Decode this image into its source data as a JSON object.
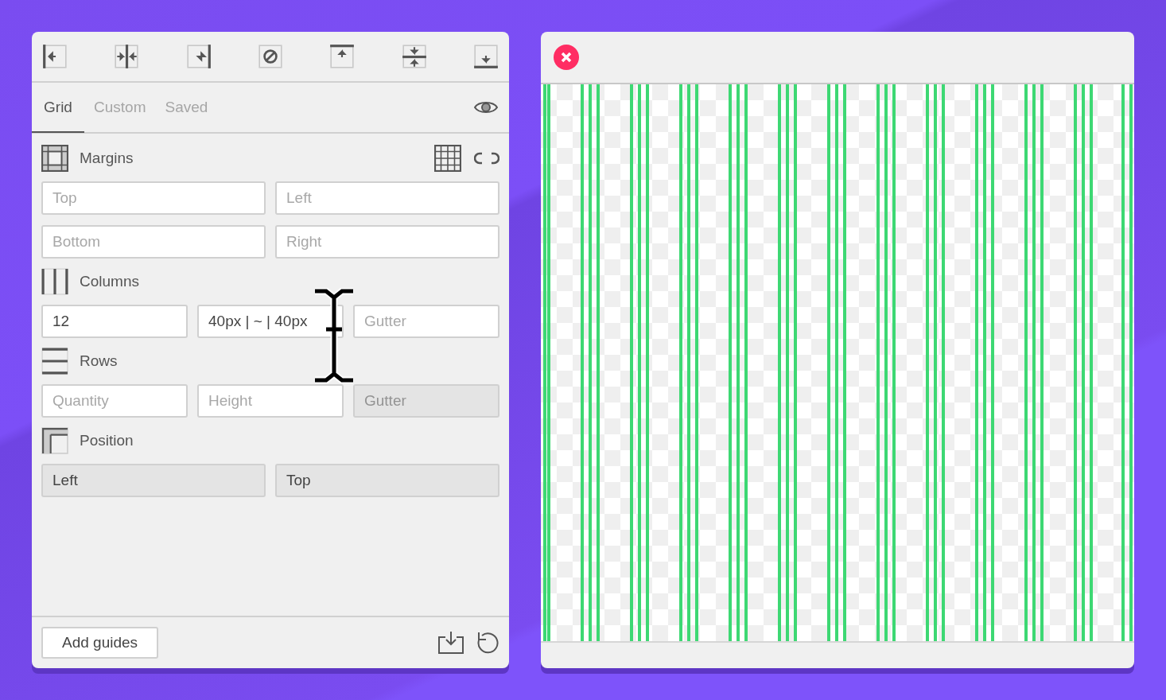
{
  "toolbar": {
    "buttons": [
      {
        "kind": "left"
      },
      {
        "kind": "center-v"
      },
      {
        "kind": "right"
      },
      {
        "kind": "clear"
      },
      {
        "kind": "top"
      },
      {
        "kind": "center-h"
      },
      {
        "kind": "bottom"
      }
    ]
  },
  "tabs": [
    {
      "label": "Grid",
      "selected": true
    },
    {
      "label": "Custom",
      "selected": false
    },
    {
      "label": "Saved",
      "selected": false
    }
  ],
  "sections": [
    {
      "kind": "margins",
      "title": "Margins",
      "fields": [
        {
          "placeholder": "Top",
          "disabled": false
        },
        {
          "placeholder": "Left",
          "disabled": false
        },
        {
          "placeholder": "Bottom",
          "disabled": false
        },
        {
          "placeholder": "Right",
          "disabled": false
        }
      ]
    },
    {
      "kind": "columns",
      "title": "Columns",
      "fields": [
        {
          "value": "12",
          "disabled": false
        },
        {
          "value": "40px | ~ | 40px",
          "disabled": false
        },
        {
          "placeholder": "Gutter",
          "disabled": false
        }
      ]
    },
    {
      "kind": "rows",
      "title": "Rows",
      "fields": [
        {
          "placeholder": "Quantity",
          "disabled": false
        },
        {
          "placeholder": "Height",
          "disabled": false
        },
        {
          "placeholder": "Gutter",
          "disabled": true
        }
      ]
    },
    {
      "kind": "position",
      "title": "Position",
      "fields": [
        {
          "value": "Left",
          "disabled": true
        },
        {
          "value": "Top",
          "disabled": true
        }
      ]
    }
  ],
  "footer": {
    "button": "Add guides"
  }
}
